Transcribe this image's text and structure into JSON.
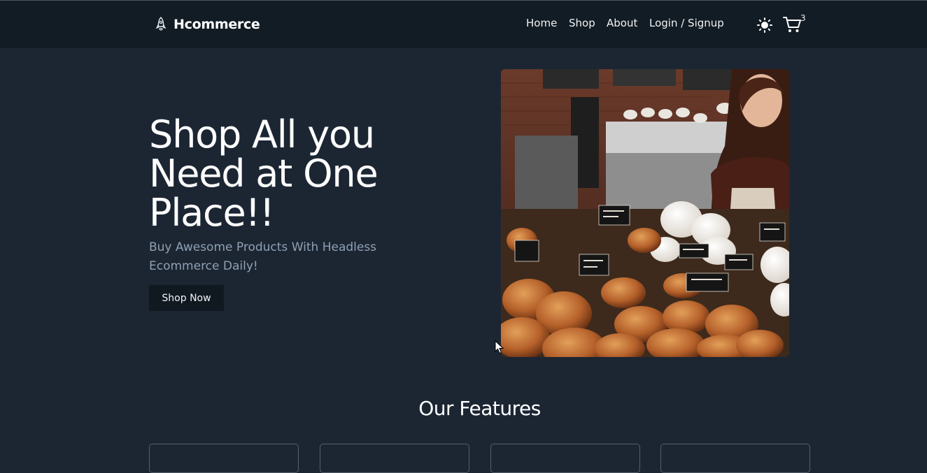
{
  "brand": {
    "name": "Hcommerce",
    "icon": "rocket-icon"
  },
  "nav": {
    "links": [
      {
        "label": "Home"
      },
      {
        "label": "Shop"
      },
      {
        "label": "About"
      },
      {
        "label": "Login / Signup"
      }
    ],
    "theme_icon": "sun-icon",
    "cart_icon": "cart-icon",
    "cart_count": "3"
  },
  "hero": {
    "title": "Shop All you Need at One Place!!",
    "subtitle": "Buy Awesome Products With Headless Ecommerce Daily!",
    "button_label": "Shop Now",
    "image": "bakery-photo"
  },
  "features": {
    "title": "Our Features",
    "cards": 4
  },
  "colors": {
    "background": "#1c2633",
    "navbar": "#121c24",
    "button": "#101820",
    "subtitle": "#8fa0b2"
  }
}
